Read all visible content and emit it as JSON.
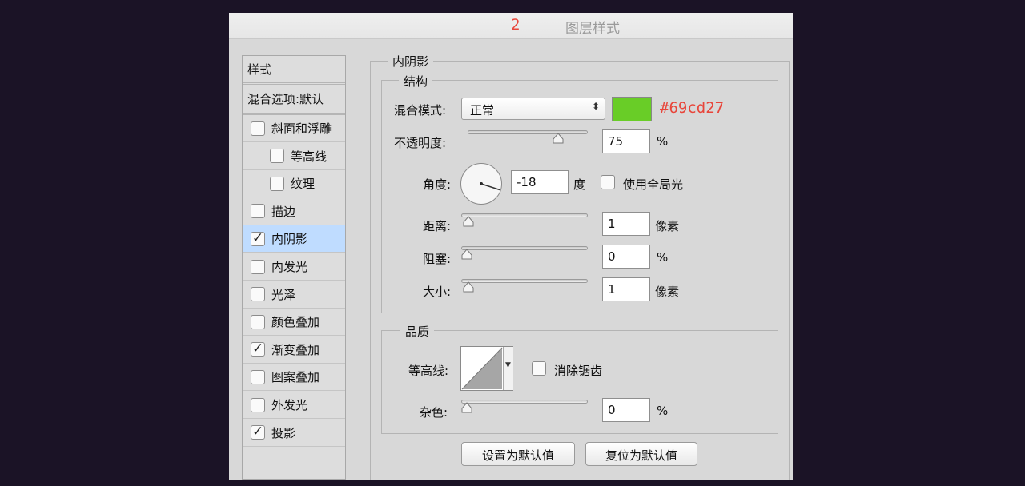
{
  "titlebar": {
    "step_number": "2",
    "title": "图层样式"
  },
  "sidebar": {
    "header": "样式",
    "blending_options": "混合选项:默认",
    "items": [
      {
        "label": "斜面和浮雕",
        "checked": false,
        "indent": false
      },
      {
        "label": "等高线",
        "checked": false,
        "indent": true
      },
      {
        "label": "纹理",
        "checked": false,
        "indent": true
      },
      {
        "label": "描边",
        "checked": false,
        "indent": false
      },
      {
        "label": "内阴影",
        "checked": true,
        "indent": false,
        "selected": true
      },
      {
        "label": "内发光",
        "checked": false,
        "indent": false
      },
      {
        "label": "光泽",
        "checked": false,
        "indent": false
      },
      {
        "label": "颜色叠加",
        "checked": false,
        "indent": false
      },
      {
        "label": "渐变叠加",
        "checked": true,
        "indent": false
      },
      {
        "label": "图案叠加",
        "checked": false,
        "indent": false
      },
      {
        "label": "外发光",
        "checked": false,
        "indent": false
      },
      {
        "label": "投影",
        "checked": true,
        "indent": false
      }
    ]
  },
  "panel": {
    "title": "内阴影",
    "structure": {
      "legend": "结构",
      "blend_mode_label": "混合模式:",
      "blend_mode_value": "正常",
      "color_hex": "#69cd27",
      "color_value": "#69cd27",
      "opacity_label": "不透明度:",
      "opacity_value": "75",
      "opacity_unit": "%",
      "opacity_fraction": 0.75,
      "angle_label": "角度:",
      "angle_value": "-18",
      "angle_unit": "度",
      "global_light_label": "使用全局光",
      "global_light_checked": false,
      "distance_label": "距离:",
      "distance_value": "1",
      "distance_unit": "像素",
      "choke_label": "阻塞:",
      "choke_value": "0",
      "choke_unit": "%",
      "size_label": "大小:",
      "size_value": "1",
      "size_unit": "像素"
    },
    "quality": {
      "legend": "品质",
      "contour_label": "等高线:",
      "anti_alias_label": "消除锯齿",
      "anti_alias_checked": false,
      "noise_label": "杂色:",
      "noise_value": "0",
      "noise_unit": "%"
    },
    "buttons": {
      "set_default": "设置为默认值",
      "reset_default": "复位为默认值"
    }
  },
  "colors": {
    "accent_red": "#e8453a",
    "selected_row": "#bfdcff"
  }
}
